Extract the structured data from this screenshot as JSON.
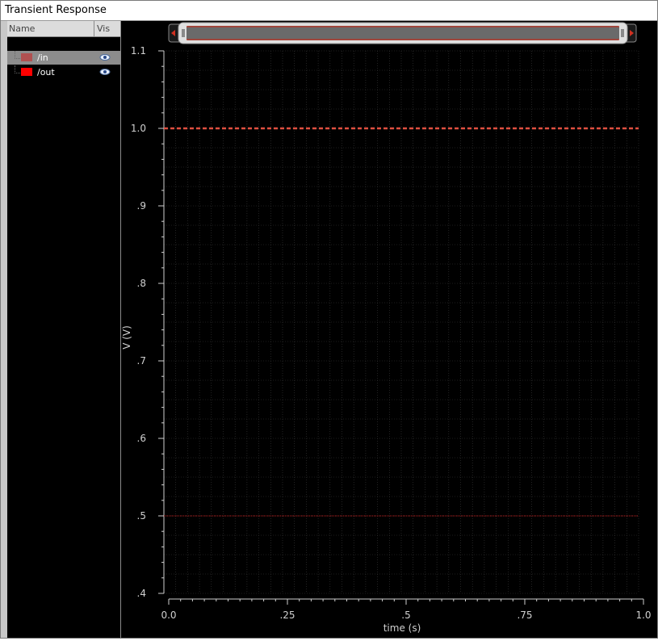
{
  "window": {
    "title": "Transient Response"
  },
  "browser": {
    "col_name": "Name",
    "col_vis": "Vis",
    "signals": [
      {
        "name": "/in",
        "color": "#b05050",
        "selected": true,
        "visible": true
      },
      {
        "name": "/out",
        "color": "#ff0000",
        "selected": false,
        "visible": true
      }
    ]
  },
  "colors": {
    "background": "#000000",
    "grid": "#3a3a3a",
    "axis": "#d0d0d0",
    "scrollbar": "#e0e0e0",
    "scroll_accent": "#d03020"
  },
  "chart_data": {
    "type": "line",
    "title": "",
    "xlabel": "time (s)",
    "ylabel": "V (V)",
    "xlim": [
      0.0,
      1.0
    ],
    "ylim": [
      0.4,
      1.1
    ],
    "x_ticks": [
      "0.0",
      ".25",
      ".5",
      ".75",
      "1.0"
    ],
    "y_ticks": [
      ".4",
      ".5",
      ".6",
      ".7",
      ".8",
      ".9",
      "1.0",
      "1.1"
    ],
    "grid": true,
    "series": [
      {
        "name": "/in",
        "color": "#e05040",
        "style": "dashed",
        "x": [
          0.0,
          1.0
        ],
        "y": [
          1.0,
          1.0
        ]
      },
      {
        "name": "/out",
        "color": "#cc2222",
        "style": "dotted",
        "x": [
          0.0,
          1.0
        ],
        "y": [
          0.5,
          0.5
        ]
      }
    ]
  }
}
